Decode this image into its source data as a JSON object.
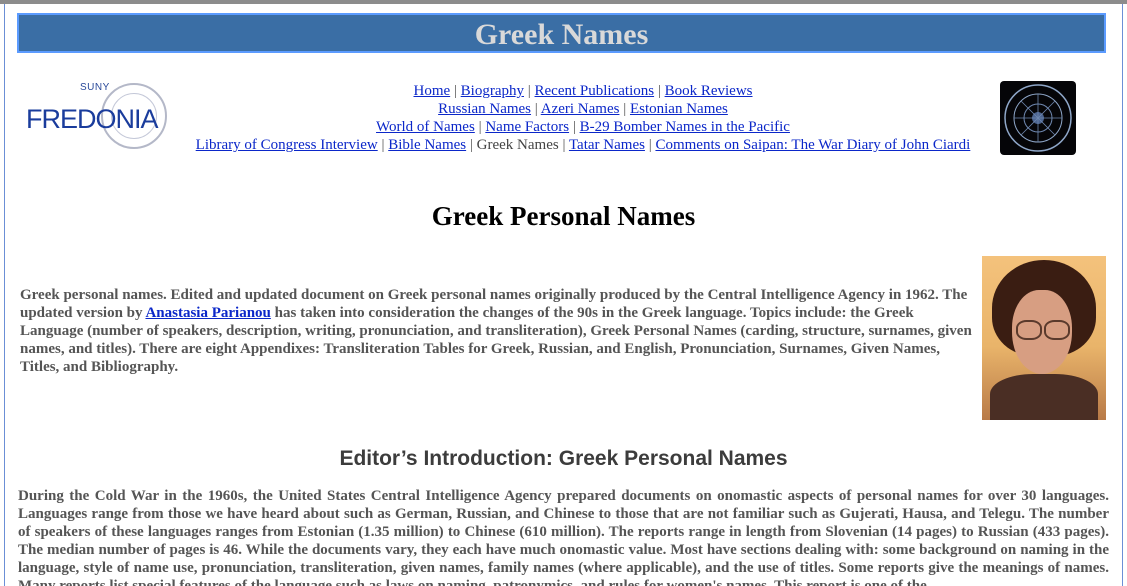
{
  "banner": {
    "title": "Greek Names"
  },
  "logos": {
    "left_suny": "SUNY",
    "left_fredonia": "FREDONIA"
  },
  "nav": {
    "rows": [
      [
        {
          "label": "Home",
          "link": true
        },
        {
          "label": "Biography",
          "link": true
        },
        {
          "label": "Recent Publications",
          "link": true
        },
        {
          "label": "Book Reviews",
          "link": true
        }
      ],
      [
        {
          "label": "Russian Names",
          "link": true
        },
        {
          "label": "Azeri Names",
          "link": true
        },
        {
          "label": "Estonian Names",
          "link": true
        }
      ],
      [
        {
          "label": "World of Names",
          "link": true
        },
        {
          "label": "Name Factors",
          "link": true
        },
        {
          "label": "B-29 Bomber Names in the Pacific",
          "link": true
        }
      ],
      [
        {
          "label": "Library of Congress Interview",
          "link": true
        },
        {
          "label": "Bible Names",
          "link": true
        },
        {
          "label": "Greek Names",
          "link": false
        },
        {
          "label": "Tatar Names",
          "link": true
        },
        {
          "label": "Comments on Saipan: The War Diary of John Ciardi",
          "link": true
        }
      ]
    ],
    "separator": "|"
  },
  "page": {
    "title": "Greek Personal Names"
  },
  "intro": {
    "part1": "Greek personal names. Edited and updated document on Greek personal names originally produced by the Central Intelligence Agency in 1962. The updated version by ",
    "author_link": "Anastasia Parianou",
    "part2": " has taken into consideration the changes of the 90s in the Greek language. Topics include: the Greek Language (number of speakers, description, writing, pronunciation, and transliteration), Greek Personal Names (carding, structure, surnames, given names, and titles). There are eight Appendixes: Transliteration Tables for Greek, Russian, and English, Pronunciation, Surnames, Given Names, Titles, and Bibliography."
  },
  "section": {
    "heading": "Editor’s Introduction: Greek Personal Names",
    "body": "During the Cold War in the 1960s, the United States Central Intelligence Agency prepared documents on onomastic aspects of personal names for over 30 languages. Languages range from those we have heard about such as German, Russian, and Chinese to those that are not familiar such as Gujerati, Hausa, and Telegu. The number of speakers of these languages ranges from Estonian (1.35 million) to Chinese (610 million). The reports range in length from Slovenian (14 pages) to Russian (433 pages). The median number of pages is 46. While the documents vary, they each have much onomastic value. Most have sections dealing with: some background on naming in the language, style of name use, pronunciation, transliteration, given names, family names (where applicable), and the use of titles. Some reports give the meanings of names. Many reports list special features of the language such as laws on naming, patronymics, and rules for women's names. This report is one of the"
  },
  "colors": {
    "banner_bg": "#3a6ea5",
    "banner_border": "#5b9bff",
    "link": "#0b27c9",
    "body_text": "#555555"
  }
}
